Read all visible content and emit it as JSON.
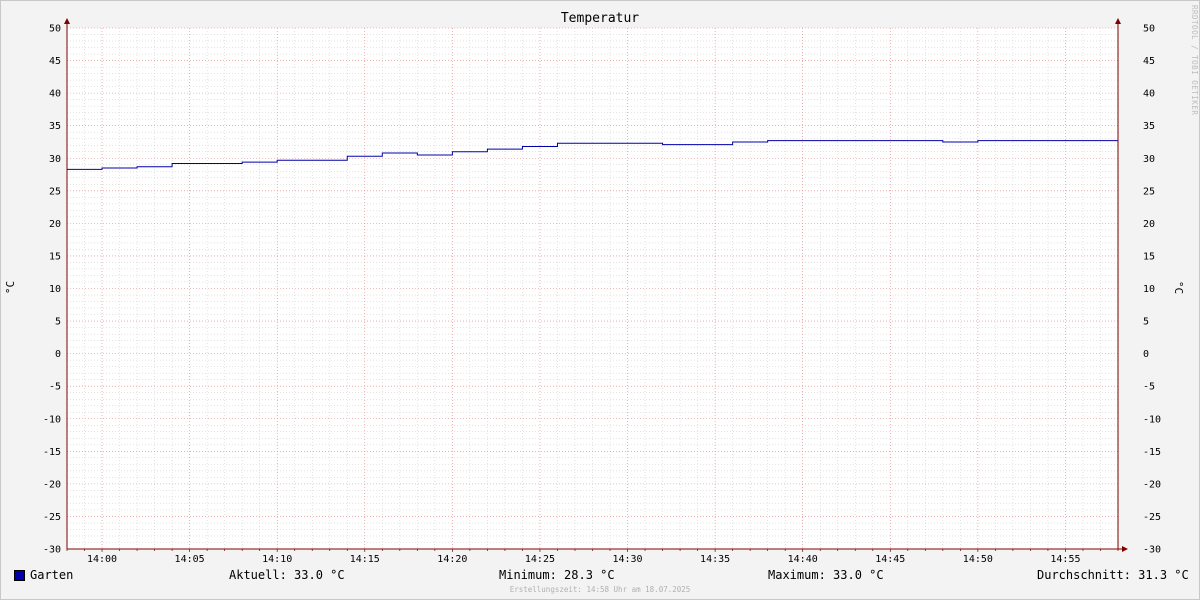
{
  "chart_data": {
    "type": "line",
    "title": "Temperatur",
    "ylabel": "°C",
    "ylabel_right": "°C",
    "watermark": "RRDTOOL / TOBI OETIKER",
    "ylim": [
      -30,
      50
    ],
    "yticks": [
      50,
      45,
      40,
      35,
      30,
      25,
      20,
      15,
      10,
      5,
      0,
      -5,
      -10,
      -15,
      -20,
      -25,
      -30
    ],
    "xlim": [
      "13:58",
      "14:58"
    ],
    "xticks": [
      "14:00",
      "14:05",
      "14:10",
      "14:15",
      "14:20",
      "14:25",
      "14:30",
      "14:35",
      "14:40",
      "14:45",
      "14:50",
      "14:55"
    ],
    "grid": true,
    "series": [
      {
        "name": "Garten",
        "color": "#0000aa",
        "x": [
          "13:58",
          "14:00",
          "14:02",
          "14:04",
          "14:08",
          "14:10",
          "14:14",
          "14:16",
          "14:18",
          "14:20",
          "14:22",
          "14:24",
          "14:26",
          "14:32",
          "14:36",
          "14:38",
          "14:48",
          "14:50",
          "14:58"
        ],
        "values": [
          28.3,
          28.5,
          28.7,
          29.2,
          29.4,
          29.7,
          30.3,
          30.8,
          30.5,
          31.0,
          31.4,
          31.8,
          32.3,
          32.1,
          32.5,
          32.7,
          32.5,
          32.7,
          33.0
        ]
      }
    ],
    "legend": {
      "name": "Garten",
      "aktuell": "Aktuell: 33.0 °C",
      "minimum": "Minimum: 28.3 °C",
      "maximum": "Maximum: 33.0 °C",
      "durchschnitt": "Durchschnitt: 31.3 °C"
    },
    "footer": "Erstellungszeit: 14:58 Uhr am 18.07.2025",
    "colors": {
      "background": "#f3f3f3",
      "canvas": "#ffffff",
      "major_grid": "#e08080",
      "minor_grid": "#c8c8c8",
      "axis": "#800000"
    }
  }
}
